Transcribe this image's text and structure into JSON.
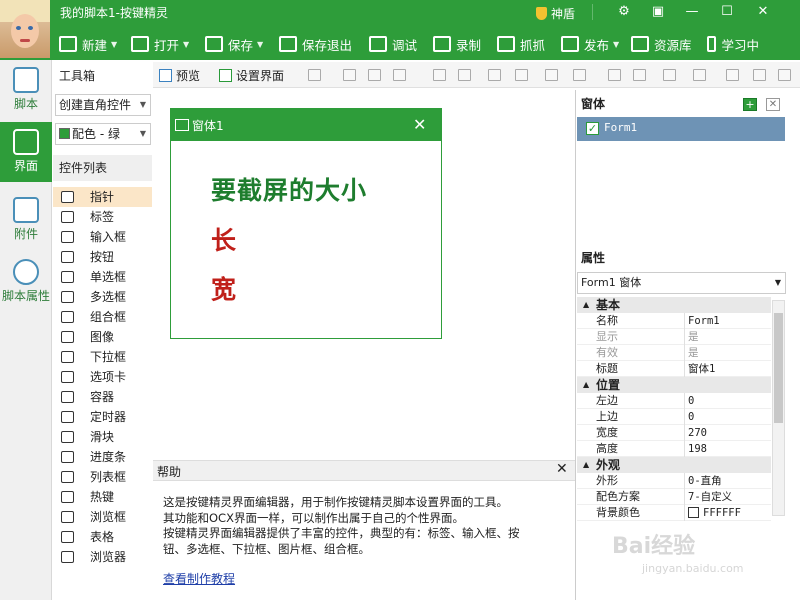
{
  "window": {
    "title": "我的脚本1-按键精灵",
    "shield_label": "神盾"
  },
  "toolbar": {
    "items": [
      {
        "label": "新建",
        "dropdown": true
      },
      {
        "label": "打开",
        "dropdown": true
      },
      {
        "label": "保存",
        "dropdown": true
      },
      {
        "label": "保存退出",
        "dropdown": false
      },
      {
        "label": "调试",
        "dropdown": false
      },
      {
        "label": "录制",
        "dropdown": false
      },
      {
        "label": "抓抓",
        "dropdown": false
      },
      {
        "label": "发布",
        "dropdown": true
      },
      {
        "label": "资源库",
        "dropdown": false
      },
      {
        "label": "学习中",
        "dropdown": false
      }
    ]
  },
  "nav": {
    "items": [
      {
        "label": "脚本"
      },
      {
        "label": "界面"
      },
      {
        "label": "附件"
      },
      {
        "label": "脚本属性"
      }
    ],
    "active": "界面"
  },
  "toolbox": {
    "title": "工具箱",
    "mode_select": "创建直角控件",
    "color_select": "配色 - 绿",
    "list_title": "控件列表",
    "controls": [
      "指针",
      "标签",
      "输入框",
      "按钮",
      "单选框",
      "多选框",
      "组合框",
      "图像",
      "下拉框",
      "选项卡",
      "容器",
      "定时器",
      "滑块",
      "进度条",
      "列表框",
      "热键",
      "浏览框",
      "表格",
      "浏览器"
    ],
    "selected": "指针"
  },
  "design_toolbar": {
    "preview_label": "预览",
    "setup_label": "设置界面"
  },
  "form": {
    "title": "窗体1",
    "line1": "要截屏的大小",
    "line2": "长",
    "line3": "宽",
    "color_line1": "#1e7d2e",
    "color_other": "#c0201a"
  },
  "help": {
    "title": "帮助",
    "lines": [
      "这是按键精灵界面编辑器，用于制作按键精灵脚本设置界面的工具。",
      "其功能和OCX界面一样，可以制作出属于自己的个性界面。",
      "按键精灵界面编辑器提供了丰富的控件，典型的有：标签、输入框、按",
      "钮、多选框、下拉框、图片框、组合框。"
    ],
    "link": "查看制作教程"
  },
  "windows_panel": {
    "title": "窗体",
    "tree_item": "Form1"
  },
  "properties": {
    "title": "属性",
    "object": "Form1 窗体",
    "groups": [
      {
        "name": "基本",
        "rows": [
          {
            "name": "名称",
            "value": "Form1",
            "disabled": false
          },
          {
            "name": "显示",
            "value": "是",
            "disabled": true
          },
          {
            "name": "有效",
            "value": "是",
            "disabled": true
          },
          {
            "name": "标题",
            "value": "窗体1",
            "disabled": false
          }
        ]
      },
      {
        "name": "位置",
        "rows": [
          {
            "name": "左边",
            "value": "0",
            "disabled": false
          },
          {
            "name": "上边",
            "value": "0",
            "disabled": false
          },
          {
            "name": "宽度",
            "value": "270",
            "disabled": false
          },
          {
            "name": "高度",
            "value": "198",
            "disabled": false
          }
        ]
      },
      {
        "name": "外观",
        "rows": [
          {
            "name": "外形",
            "value": "0-直角",
            "disabled": false
          },
          {
            "name": "配色方案",
            "value": "7-自定义",
            "disabled": false
          },
          {
            "name": "背景颜色",
            "value": "FFFFFF",
            "disabled": false
          }
        ]
      }
    ]
  },
  "watermark": {
    "brand": "Bai经验",
    "url": "jingyan.baidu.com"
  },
  "colors": {
    "brand_green": "#2e9d3a",
    "selection_blue": "#6e93b5"
  }
}
